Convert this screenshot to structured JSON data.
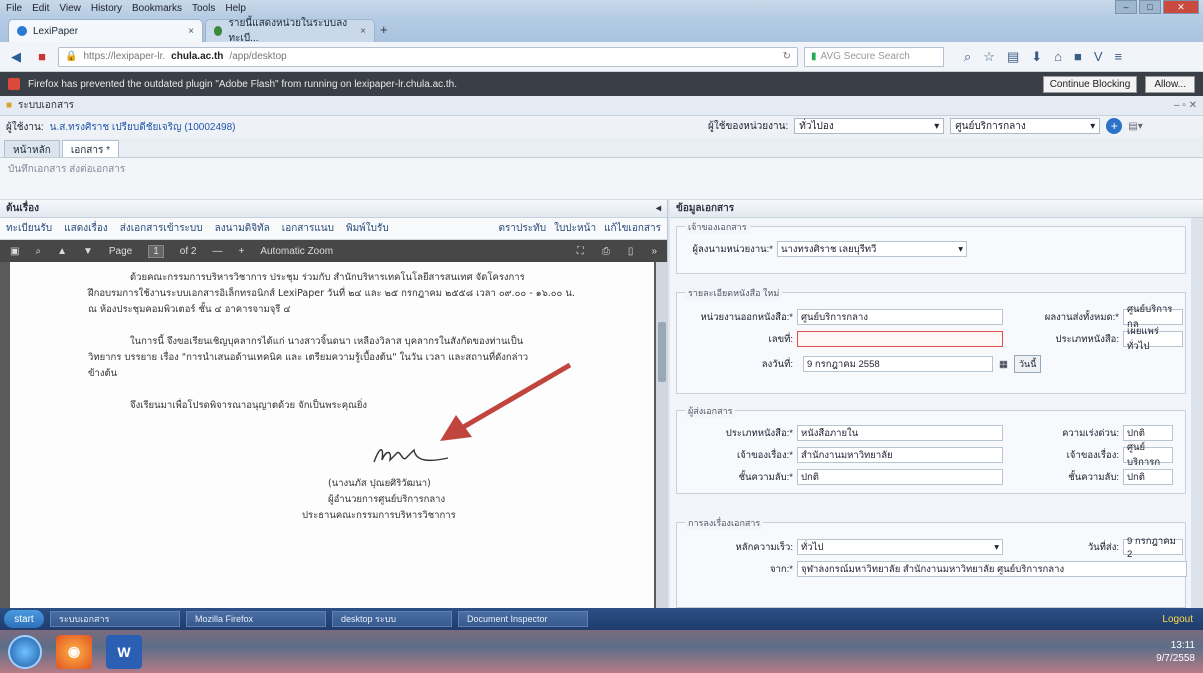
{
  "browser": {
    "menu": [
      "File",
      "Edit",
      "View",
      "History",
      "Bookmarks",
      "Tools",
      "Help"
    ],
    "tabs": [
      {
        "label": "LexiPaper",
        "active": true
      },
      {
        "label": "รายนี้แสดงหน่วยในระบบลงทะเบี...",
        "active": false
      }
    ],
    "url_prefix": "https://lexipaper-lr.",
    "url_domain": "chula.ac.th",
    "url_path": "/app/desktop",
    "search_placeholder": "AVG Secure Search",
    "notification": {
      "text": "Firefox has prevented the outdated plugin \"Adobe Flash\" from running on lexipaper-lr.chula.ac.th.",
      "continue_label": "Continue Blocking",
      "allow_label": "Allow..."
    }
  },
  "app": {
    "window_title": "ระบบเอกสาร",
    "user_label": "ผู้ใช้งาน:",
    "user_link": "น.ส.ทรงศิราช เปรียบดีชัยเจริญ (10002498)",
    "dept_label": "ผู้ใช้ของหน่วยงาน:",
    "dept_value": "ทั่วไปอง",
    "unit_value": "ศูนย์บริการกลาง",
    "tabs": [
      "หน้าหลัก",
      "เอกสาร *"
    ],
    "toolbar_hint": "บันทึกเอกสาร ส่งต่อเอกสาร"
  },
  "left": {
    "section_title": "ต้นเรื่อง",
    "doc_actions": [
      "ทะเบียนรับ",
      "แสดงเรื่อง",
      "ส่งเอกสารเข้าระบบ",
      "ลงนามดิจิทัล",
      "เอกสารแนบ",
      "พิมพ์ใบรับ"
    ],
    "doc_right": [
      "ตราประทับ",
      "ใบปะหน้า",
      "แก้ไขเอกสาร"
    ],
    "pdf": {
      "page_label": "Page",
      "page_value": "1",
      "page_total": "of 2",
      "zoom": "Automatic Zoom",
      "para1_l1": "ด้วยคณะกรรมการบริหารวิชาการ ประชุม ร่วมกับ สำนักบริหารเทคโนโลยีสารสนเทศ จัดโครงการ",
      "para1_l2": "ฝึกอบรมการใช้งานระบบเอกสารอิเล็กทรอนิกส์ LexiPaper วันที่ ๒๔ และ ๒๕ กรกฎาคม ๒๕๕๘ เวลา ๐๙.๐๐ - ๑๖.๐๐ น.",
      "para1_l3": "ณ ห้องประชุมคอมพิวเตอร์ ชั้น ๔ อาคารจามจุรี ๔",
      "para2_l1": "ในการนี้ จึงขอเรียนเชิญบุคลากรได้แก่ นางสาวจิ้นดนา เหลืองวิลาส บุคลากรในสังกัดของท่านเป็น",
      "para2_l2": "วิทยากร บรรยาย เรื่อง \"การนำเสนอด้านเทคนิค และ เตรียมความรู้เบื้องต้น\" ในวัน เวลา และสถานที่ดังกล่าว",
      "para2_l3": "ข้างต้น",
      "para3": "จึงเรียนมาเพื่อโปรดพิจารณาอนุญาตด้วย จักเป็นพระคุณยิ่ง",
      "signer_name": "(นางนภัส ปุณยศิริวัฒนา)",
      "signer_pos1": "ผู้อำนวยการศูนย์บริการกลาง",
      "signer_pos2": "ประธานคณะกรรมการบริหารวิชาการ"
    }
  },
  "right": {
    "section_title": "ข้อมูลเอกสาร",
    "g1_legend": "เจ้าของเอกสาร",
    "g1_label": "ผู้ลงนามหน่วยงาน:*",
    "g1_value": "นางทรงศิราช เลยบุรีทวี",
    "g2_legend": "รายละเอียดหนังสือ ใหม่",
    "issuer_label": "หน่วยงานออกหนังสือ:*",
    "issuer_value": "ศูนย์บริการกลาง",
    "issuer2_label": "ผลงานส่งทั้งหมด:*",
    "issuer2_value": "ศูนย์บริการกล",
    "docno_label": "เลขที่:",
    "docno_value": "",
    "type_label": "ประเภทหนังสือ:",
    "type_value": "เผยแพร่ทั่วไป",
    "date_label": "ลงวันที่:",
    "date_value": "9 กรกฎาคม 2558",
    "date_btn": "วันนี้",
    "g3_legend": "ผู้ส่งเอกสาร",
    "kind_label": "ประเภทหนังสือ:*",
    "kind_value": "หนังสือภายใน",
    "urgency_label": "ความเร่งด่วน:",
    "urgency_value": "ปกติ",
    "owner_label": "เจ้าของเรื่อง:*",
    "owner_value": "สำนักงานมหาวิทยาลัย",
    "owner2_label": "เจ้าของเรื่อง:",
    "owner2_value": "ศูนย์บริการก",
    "secret_label": "ชั้นความลับ:*",
    "secret_value": "ปกติ",
    "secret2_label": "ชั้นความลับ:",
    "secret2_value": "ปกติ",
    "g4_legend": "การลงเรื่องเอกสาร",
    "speed_label": "หลักความเร็ว:",
    "speed_value": "ทั่วไป",
    "sent_label": "วันที่ส่ง:",
    "sent_value": "9 กรกฎาคม 2",
    "from_label": "จาก:*",
    "from_value": "จุฬาลงกรณ์มหาวิทยาลัย สำนักงานมหาวิทยาลัย ศูนย์บริการกลาง"
  },
  "taskbar": {
    "start": "start",
    "items": [
      "ระบบเอกสาร",
      "Mozilla Firefox",
      "desktop ระบบ",
      "Document Inspector"
    ],
    "tray": "Logout",
    "time": "13:11",
    "date": "9/7/2558"
  },
  "colors": {
    "arrow": "#c0453f",
    "notif_bg": "#3a3f47"
  }
}
